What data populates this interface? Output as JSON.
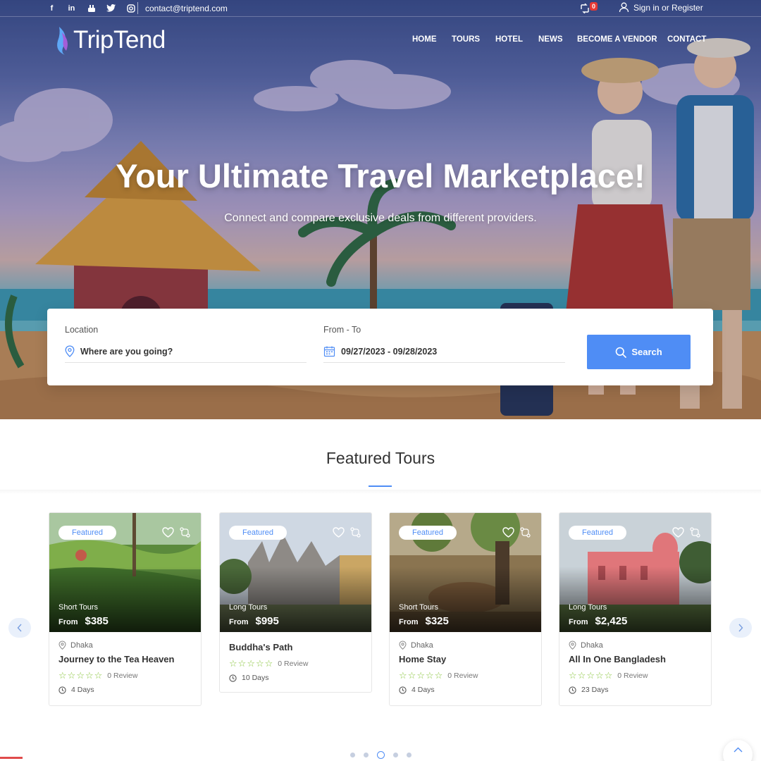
{
  "topbar": {
    "socials": [
      "facebook-icon",
      "linkedin-icon",
      "youtube-icon",
      "twitter-icon",
      "instagram-icon"
    ],
    "email": "contact@triptend.com",
    "cart_count": "0",
    "signin_label": "Sign in or Register"
  },
  "header": {
    "logo_text": "TripTend",
    "nav": [
      "HOME",
      "TOURS",
      "HOTEL",
      "NEWS",
      "BECOME A VENDOR",
      "CONTACT"
    ]
  },
  "hero": {
    "title": "Your Ultimate Travel Marketplace!",
    "subtitle": "Connect and compare exclusive deals from different providers."
  },
  "search": {
    "location_label": "Location",
    "location_placeholder": "Where are you going?",
    "dates_label": "From - To",
    "dates_value": "09/27/2023 - 09/28/2023",
    "button_label": "Search"
  },
  "featured": {
    "title": "Featured Tours",
    "cards": [
      {
        "badge": "Featured",
        "category": "Short Tours",
        "from_label": "From",
        "price": "$385",
        "location": "Dhaka",
        "title": "Journey to the Tea Heaven",
        "reviews": "0 Review",
        "duration": "4 Days"
      },
      {
        "badge": "Featured",
        "category": "Long Tours",
        "from_label": "From",
        "price": "$995",
        "location": "",
        "title": "Buddha's Path",
        "reviews": "0 Review",
        "duration": "10 Days"
      },
      {
        "badge": "Featured",
        "category": "Short Tours",
        "from_label": "From",
        "price": "$325",
        "location": "Dhaka",
        "title": "Home Stay",
        "reviews": "0 Review",
        "duration": "4 Days"
      },
      {
        "badge": "Featured",
        "category": "Long Tours",
        "from_label": "From",
        "price": "$2,425",
        "location": "Dhaka",
        "title": "All In One Bangladesh",
        "reviews": "0 Review",
        "duration": "23 Days"
      }
    ]
  },
  "colors": {
    "accent": "#4f8df5",
    "star": "#8ac63e",
    "cart_badge": "#e53935"
  }
}
